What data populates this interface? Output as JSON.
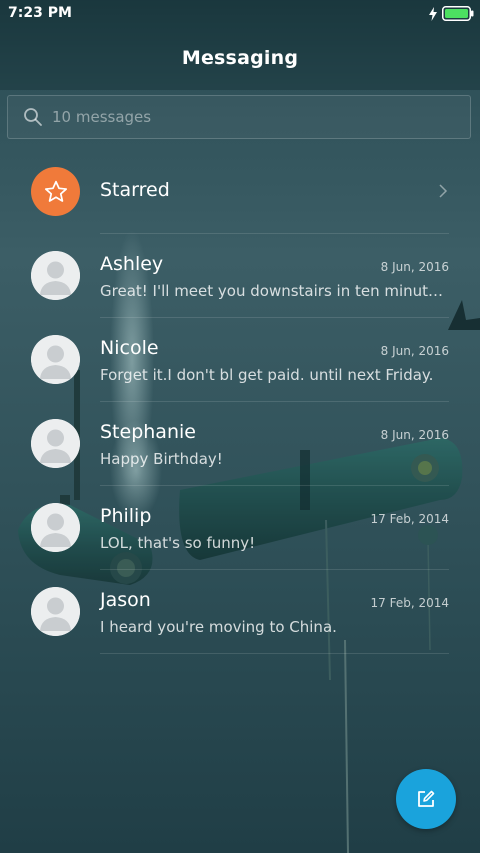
{
  "status_bar": {
    "time": "7:23 PM",
    "battery_icon": "battery-full-icon",
    "charging_icon": "charging-bolt-icon",
    "battery_color": "#4ce061"
  },
  "header": {
    "title": "Messaging"
  },
  "search": {
    "placeholder": "10 messages",
    "icon": "search-icon"
  },
  "starred": {
    "label": "Starred",
    "icon": "star-icon",
    "color": "#f07a3a"
  },
  "conversations": [
    {
      "name": "Ashley",
      "date": "8 Jun, 2016",
      "preview": "Great! I'll meet you downstairs in ten minutes. I'll be waiting for you.",
      "avatar": "default-avatar-icon"
    },
    {
      "name": "Nicole",
      "date": "8 Jun, 2016",
      "preview": "Forget it.I don't bl get paid. until next Friday.",
      "avatar": "default-avatar-icon"
    },
    {
      "name": "Stephanie",
      "date": "8 Jun, 2016",
      "preview": "Happy Birthday!",
      "avatar": "default-avatar-icon"
    },
    {
      "name": "Philip",
      "date": "17 Feb, 2014",
      "preview": "LOL, that's so funny!",
      "avatar": "default-avatar-icon"
    },
    {
      "name": "Jason",
      "date": "17 Feb, 2014",
      "preview": "I heard you're moving to China.",
      "avatar": "default-avatar-icon"
    }
  ],
  "fab": {
    "icon": "compose-icon",
    "color": "#1aa3dc"
  }
}
